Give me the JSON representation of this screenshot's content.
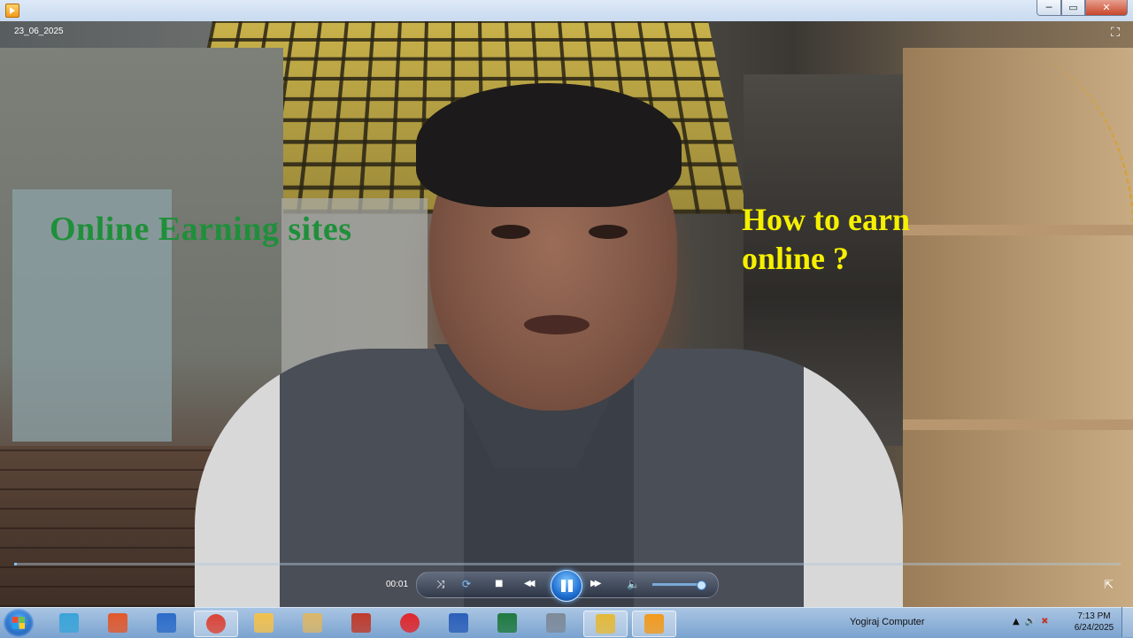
{
  "window": {
    "controls": {
      "minimize": "─",
      "maximize": "▭",
      "close": "✕"
    }
  },
  "video": {
    "date_stamp": "23_06_2025",
    "overlay_left": "Online Earning sites",
    "overlay_right_line1": "How to earn",
    "overlay_right_line2": "online ?",
    "overlay_left_color": "#1f8f3a",
    "overlay_right_color": "#f5f000"
  },
  "player": {
    "elapsed_time": "00:01",
    "progress_fraction": 0.002,
    "volume_fraction": 0.95,
    "icons": {
      "fullscreen_toggle": "corner-arrows-icon",
      "shuffle": "shuffle-icon",
      "repeat": "repeat-icon",
      "stop": "stop-icon",
      "previous": "rewind-icon",
      "play_pause": "pause-icon",
      "next": "fast-forward-icon",
      "volume": "speaker-icon",
      "switch_to_library": "expand-icon"
    },
    "glyphs": {
      "shuffle": "⤨",
      "repeat": "⟳",
      "stop": "■",
      "previous": "◀◀",
      "next": "▶▶",
      "volume": "🔈",
      "expand": "⇱",
      "fullscreen": "⛶"
    }
  },
  "taskbar": {
    "items": [
      {
        "name": "explorer-window-icon",
        "color": "#3aa4d8",
        "active": false
      },
      {
        "name": "paint-fire-icon",
        "color": "#e2582b",
        "active": false
      },
      {
        "name": "media-player-icon",
        "color": "#2c6cc9",
        "active": false
      },
      {
        "name": "chrome-icon",
        "color": "#db4437",
        "active": true
      },
      {
        "name": "folder-icon",
        "color": "#f2c14e",
        "active": false
      },
      {
        "name": "paint-palette-icon",
        "color": "#d9b66a",
        "active": false
      },
      {
        "name": "app-window-icon",
        "color": "#c0392b",
        "active": false
      },
      {
        "name": "opera-icon",
        "color": "#e0262b",
        "active": false
      },
      {
        "name": "word-icon",
        "color": "#2b5fb9",
        "active": false
      },
      {
        "name": "excel-icon",
        "color": "#1f7a3f",
        "active": false
      },
      {
        "name": "calculator-icon",
        "color": "#7d8a99",
        "active": false
      },
      {
        "name": "pineapple-app-icon",
        "color": "#e4b93a",
        "active": true
      },
      {
        "name": "media-player-classic-icon",
        "color": "#f29a1c",
        "active": true
      }
    ],
    "toolbar_label": "Yogiraj Computer",
    "tray_glyphs": {
      "arrow": "▲",
      "volume": "🔊",
      "network": "✖"
    },
    "time": "7:13 PM",
    "date": "6/24/2025"
  }
}
